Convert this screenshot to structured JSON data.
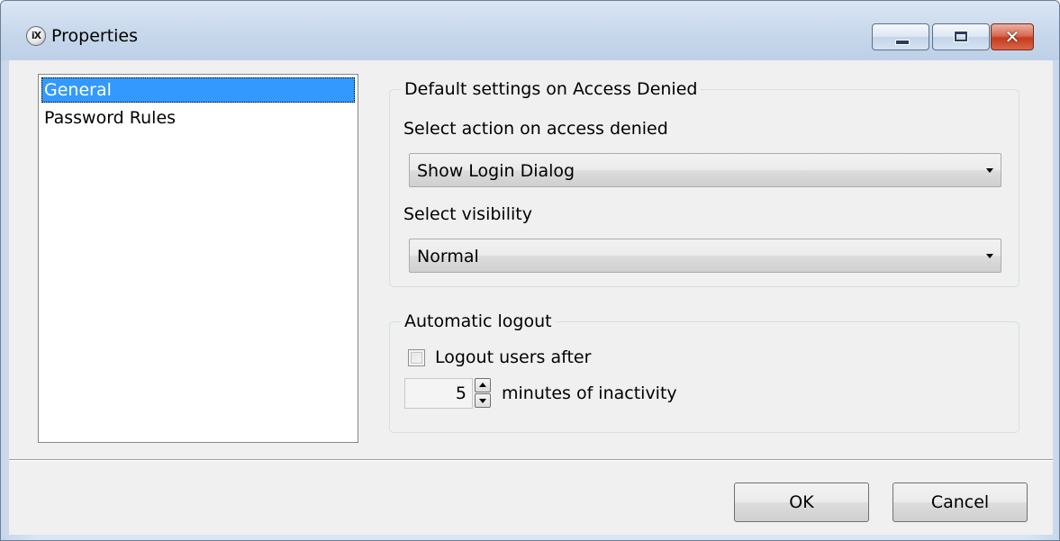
{
  "window": {
    "icon_text": "iX",
    "title": "Properties"
  },
  "titlebar_buttons": {
    "minimize": "minimize-icon",
    "maximize": "maximize-icon",
    "close": "close-icon",
    "close_glyph": "✕"
  },
  "sidebar": {
    "items": [
      {
        "label": "General",
        "selected": true
      },
      {
        "label": "Password Rules",
        "selected": false
      }
    ]
  },
  "access_denied": {
    "group_title": "Default settings on Access Denied",
    "action_label": "Select action on access denied",
    "action_value": "Show Login Dialog",
    "visibility_label": "Select visibility",
    "visibility_value": "Normal"
  },
  "auto_logout": {
    "group_title": "Automatic logout",
    "checkbox_label": "Logout users after",
    "checked": false,
    "minutes_value": "5",
    "minutes_suffix": "minutes of inactivity"
  },
  "footer": {
    "ok_label": "OK",
    "cancel_label": "Cancel"
  }
}
